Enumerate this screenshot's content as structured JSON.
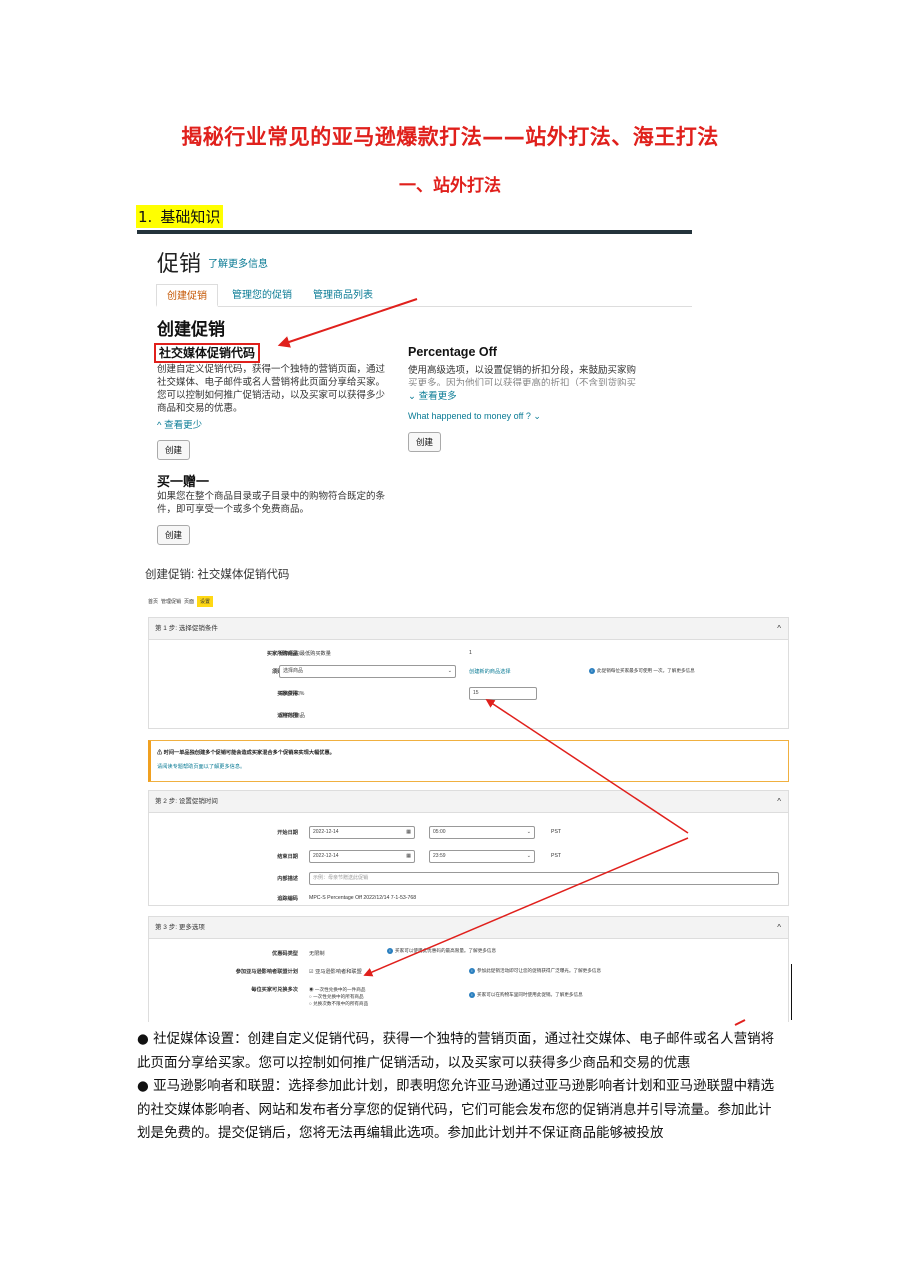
{
  "document": {
    "title": "揭秘行业常见的亚马逊爆款打法——站外打法、海王打法",
    "section": "一、站外打法",
    "numbered_heading": {
      "number": "1.",
      "text": "基础知识"
    }
  },
  "promo_page": {
    "header": "促销",
    "learn_more": "了解更多信息",
    "tabs": [
      "创建促销",
      "管理您的促销",
      "管理商品列表"
    ],
    "active_tab": "创建促销",
    "section_title": "创建促销",
    "social_media": {
      "title": "社交媒体促销代码",
      "desc": [
        "创建自定义促销代码，获得一个独特的营销页面，通过",
        "社交媒体、电子邮件或名人营销将此页面分享给买家。",
        "您可以控制如何推广促销活动，以及买家可以获得多少",
        "商品和交易的优惠。"
      ],
      "toggle": "^ 查看更少",
      "button": "创建"
    },
    "percentage_off": {
      "title": "Percentage Off",
      "desc": [
        "使用高级选项，以设置促销的折扣分段，来鼓励买家购",
        "买更多。因为他们可以获得更高的折扣（不含到货购买"
      ],
      "toggle": "⌄ 查看更多",
      "question": "What happened to money off ? ⌄",
      "button": "创建"
    },
    "buy_one_get_one": {
      "title": "买一赠一",
      "desc": [
        "如果您在整个商品目录或子目录中的购物符合既定的条",
        "件，即可享受一个或多个免费商品。"
      ],
      "button": "创建"
    }
  },
  "form_page": {
    "title": "创建促销: 社交媒体促销代码",
    "breadcrumbs": [
      "首页",
      "管理促销",
      "页面",
      "设置"
    ],
    "step1": {
      "header": "第 1 步: 选择促销条件",
      "rows": [
        {
          "label": "买家所购商品",
          "value": "此商品的最低购买数量",
          "extra": "1"
        },
        {
          "label": "须购买商品",
          "value": "选择商品",
          "extra": "创建新的商品选择"
        },
        {
          "label": "买家获得",
          "value": "减免折扣%",
          "extra": "15"
        },
        {
          "label": "适用范围",
          "value": "须购买商品",
          "extra": ""
        }
      ],
      "info": "此促销每位买家最多可使用 一次。了解更多信息"
    },
    "warning": {
      "title": "⚠ 时间一单品独创建多个促销可能会造成买家混合多个促销来实现大幅优惠。",
      "body": "请阅读专题帮助页面以了解更多信息。"
    },
    "step2": {
      "header": "第 2 步: 设置促销时间",
      "rows": [
        {
          "label": "开始日期",
          "value": "2022-12-14",
          "time": "05:00",
          "tz": "PST"
        },
        {
          "label": "结束日期",
          "value": "2022-12-14",
          "time": "23:59",
          "tz": "PST"
        },
        {
          "label": "内部描述",
          "value": "示例：母亲节赠送此促销"
        },
        {
          "label": "追踪编码",
          "value": "MPC-S Percentage Off 2022/12/14 7-1-53-768"
        }
      ]
    },
    "step3": {
      "header": "第 3 步: 更多选项",
      "rows": [
        {
          "label": "优惠码类型",
          "value": "无限制",
          "info": "买家可以使用此优惠码的最高限量。了解更多信息"
        },
        {
          "label": "参加亚马逊影响者联盟计划",
          "value": "☑ 亚马逊影响者和联盟",
          "info": "参加此促销活动即可让您的促销获得广泛曝光。了解更多信息"
        },
        {
          "label": "每位买家可兑换多次",
          "options": [
            "一次性兑换中的一件商品",
            "一次性兑换中的所有商品",
            "兑换次数不限中的所有商品"
          ],
          "info": "买家可以在购物车里同时使用此促销。了解更多信息"
        }
      ]
    }
  },
  "bullets": [
    "● 社促媒体设置：创建自定义促销代码，获得一个独特的营销页面，通过社交媒体、电子邮件或名人营销将此页面分享给买家。您可以控制如何推广促销活动，以及买家可以获得多少商品和交易的优惠",
    "● 亚马逊影响者和联盟：选择参加此计划，即表明您允许亚马逊通过亚马逊影响者计划和亚马逊联盟中精选的社交媒体影响者、网站和发布者分享您的促销代码，它们可能会发布您的促销消息并引导流量。参加此计划是免费的。提交促销后，您将无法再编辑此选项。参加此计划并不保证商品能够被投放"
  ],
  "colors": {
    "title_red": "#e0201c",
    "highlight": "#ffff00",
    "link_teal": "#0a7b95",
    "rule": "#24333b"
  }
}
